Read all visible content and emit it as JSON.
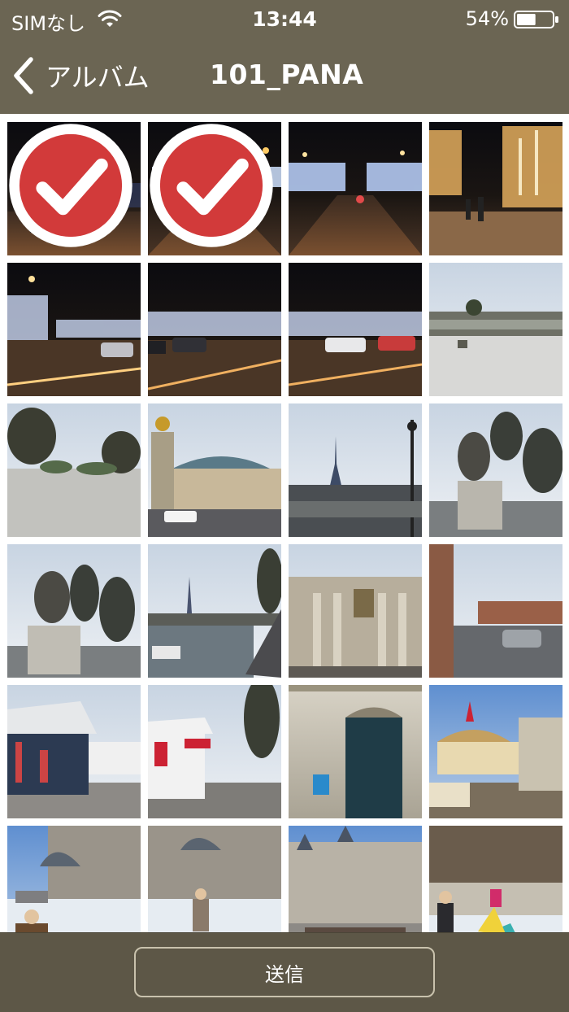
{
  "status_bar": {
    "carrier": "SIMなし",
    "time": "13:44",
    "battery": "54%",
    "battery_level": 0.54,
    "icons": [
      "wifi-icon",
      "battery-icon"
    ]
  },
  "nav": {
    "back_label": "アルバム",
    "back_icon": "chevron-left-icon",
    "title": "101_PANA"
  },
  "photos": [
    {
      "name": "photo-night-street-1",
      "selected": true
    },
    {
      "name": "photo-night-arc",
      "selected": true
    },
    {
      "name": "photo-night-avenue",
      "selected": false
    },
    {
      "name": "photo-night-trees",
      "selected": false
    },
    {
      "name": "photo-night-traffic-1",
      "selected": false
    },
    {
      "name": "photo-night-traffic-2",
      "selected": false
    },
    {
      "name": "photo-night-traffic-3",
      "selected": false
    },
    {
      "name": "photo-snowy-garden",
      "selected": false
    },
    {
      "name": "photo-park-trees",
      "selected": false
    },
    {
      "name": "photo-grand-palais",
      "selected": false
    },
    {
      "name": "photo-eiffel-tower",
      "selected": false
    },
    {
      "name": "photo-lion-statue-1",
      "selected": false
    },
    {
      "name": "photo-lion-statue-2",
      "selected": false
    },
    {
      "name": "photo-seine-river",
      "selected": false
    },
    {
      "name": "photo-museum-facade",
      "selected": false
    },
    {
      "name": "photo-street-cars",
      "selected": false
    },
    {
      "name": "photo-market-stall-1",
      "selected": false
    },
    {
      "name": "photo-market-stall-2",
      "selected": false
    },
    {
      "name": "photo-green-door",
      "selected": false
    },
    {
      "name": "photo-carousel",
      "selected": false
    },
    {
      "name": "photo-ice-rink-1",
      "selected": false
    },
    {
      "name": "photo-ice-rink-2",
      "selected": false
    },
    {
      "name": "photo-hotel-de-ville",
      "selected": false
    },
    {
      "name": "photo-ice-rink-kids",
      "selected": false
    }
  ],
  "toolbar": {
    "send_label": "送信"
  },
  "colors": {
    "bar": "#6b6553",
    "toolbar": "#5d5747",
    "check": "#d23a3a"
  }
}
